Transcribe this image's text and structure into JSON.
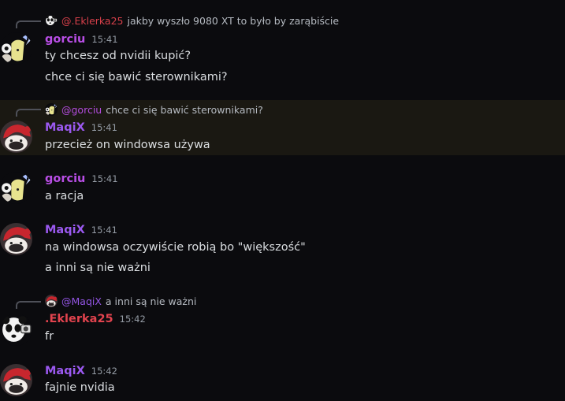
{
  "colors": {
    "background": "#0b0b0e",
    "highlight": "#1a1812",
    "gorciu": "#b94ee6",
    "maqix": "#9b59f0",
    "eklerka": "#e2434e",
    "timestamp": "#949ba4",
    "text": "#dbdee1"
  },
  "messages": [
    {
      "reply": {
        "name": "@.Eklerka25",
        "text": "jakby wyszło 9080 XT to było by zarąbiście",
        "avatar_icon": "panda-avatar-icon"
      },
      "author": "gorciu",
      "time": "15:41",
      "avatar_icon": "cartoon-character-avatar-icon",
      "lines": [
        "ty chcesz od nvidii kupić?",
        "chce ci się bawić sterownikami?"
      ]
    },
    {
      "reply": {
        "name": "@gorciu",
        "text": "chce ci się bawić sterownikami?",
        "avatar_icon": "cartoon-character-avatar-icon"
      },
      "author": "MaqiX",
      "time": "15:41",
      "avatar_icon": "red-hat-avatar-icon",
      "lines": [
        "przecież on windowsa używa"
      ]
    },
    {
      "author": "gorciu",
      "time": "15:41",
      "avatar_icon": "cartoon-character-avatar-icon",
      "lines": [
        "a racja"
      ]
    },
    {
      "author": "MaqiX",
      "time": "15:41",
      "avatar_icon": "red-hat-avatar-icon",
      "lines": [
        "na windowsa oczywiście robią bo \"większość\"",
        "a inni są nie ważni"
      ]
    },
    {
      "reply": {
        "name": "@MaqiX",
        "text": "a inni są nie ważni",
        "avatar_icon": "red-hat-avatar-icon"
      },
      "author": ".Eklerka25",
      "time": "15:42",
      "avatar_icon": "panda-avatar-icon",
      "lines": [
        "fr"
      ]
    },
    {
      "author": "MaqiX",
      "time": "15:42",
      "avatar_icon": "red-hat-avatar-icon",
      "lines": [
        "fajnie nvidia"
      ]
    }
  ]
}
